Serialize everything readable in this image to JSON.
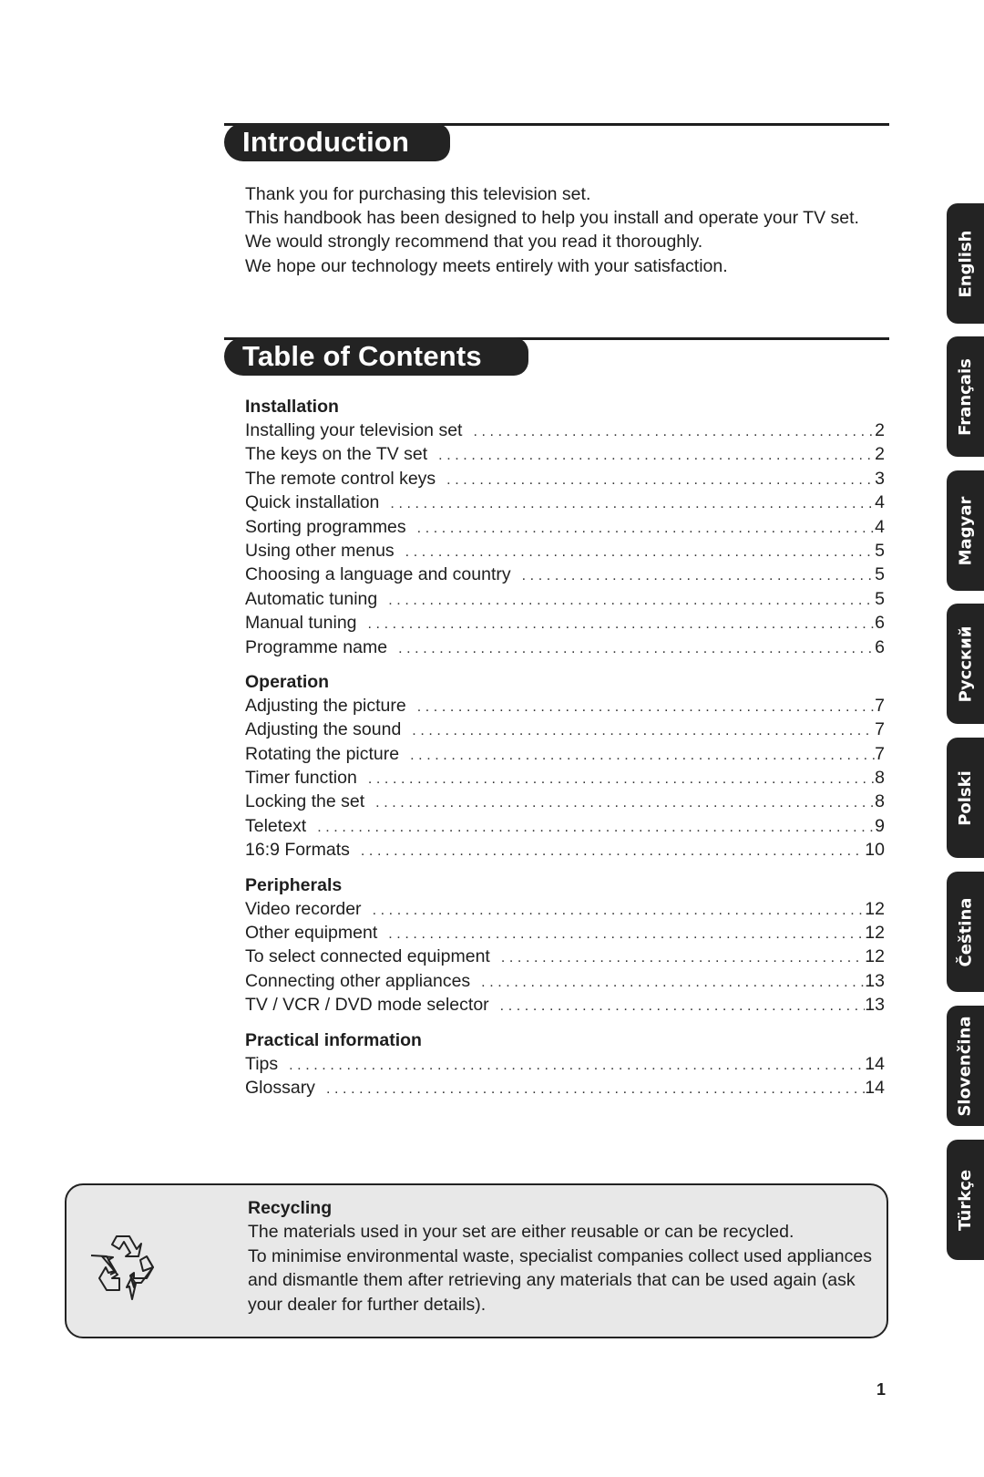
{
  "intro": {
    "heading": "Introduction",
    "lines": [
      "Thank you for purchasing this television set.",
      "This handbook has been designed to help you install and operate your TV set.",
      "We would strongly recommend that you read it thoroughly.",
      "We hope our technology meets entirely with your satisfaction."
    ]
  },
  "toc": {
    "heading": "Table of Contents",
    "groups": [
      {
        "title": "Installation",
        "entries": [
          {
            "label": "Installing your television set",
            "page": "2"
          },
          {
            "label": "The keys on the TV set",
            "page": "2"
          },
          {
            "label": "The remote control keys",
            "page": "3"
          },
          {
            "label": "Quick installation",
            "page": "4"
          },
          {
            "label": "Sorting programmes",
            "page": "4"
          },
          {
            "label": "Using other menus",
            "page": "5"
          },
          {
            "label": "Choosing a language and country",
            "page": "5"
          },
          {
            "label": "Automatic tuning",
            "page": "5"
          },
          {
            "label": "Manual tuning",
            "page": "6"
          },
          {
            "label": "Programme name",
            "page": "6"
          }
        ]
      },
      {
        "title": "Operation",
        "entries": [
          {
            "label": "Adjusting the picture",
            "page": "7"
          },
          {
            "label": "Adjusting the sound",
            "page": "7"
          },
          {
            "label": "Rotating the picture",
            "page": "7"
          },
          {
            "label": "Timer function",
            "page": "8"
          },
          {
            "label": "Locking the set",
            "page": "8"
          },
          {
            "label": "Teletext",
            "page": "9"
          },
          {
            "label": "16:9 Formats",
            "page": "10"
          }
        ]
      },
      {
        "title": "Peripherals",
        "entries": [
          {
            "label": "Video recorder",
            "page": "12"
          },
          {
            "label": "Other equipment",
            "page": "12"
          },
          {
            "label": "To select connected equipment",
            "page": "12"
          },
          {
            "label": "Connecting other appliances",
            "page": "13"
          },
          {
            "label": "TV / VCR / DVD mode selector",
            "page": "13"
          }
        ]
      },
      {
        "title": "Practical information",
        "entries": [
          {
            "label": "Tips",
            "page": "14"
          },
          {
            "label": "Glossary",
            "page": "14"
          }
        ]
      }
    ]
  },
  "language_tabs": [
    "English",
    "Français",
    "Magyar",
    "Русский",
    "Polski",
    "Čeština",
    "Slovenčina",
    "Türkçe"
  ],
  "recycling": {
    "icon": "recycle-icon",
    "title": "Recycling",
    "lines": [
      "The materials used in your set are either reusable or can be recycled.",
      "To minimise environmental waste, specialist companies collect used appliances",
      "and dismantle them after retrieving any materials that can be used again (ask",
      "your dealer for further details)."
    ]
  },
  "page_number": "1",
  "colors": {
    "header_fill": "#232323",
    "box_fill": "#e8e8e8",
    "text": "#1e1e1e"
  }
}
